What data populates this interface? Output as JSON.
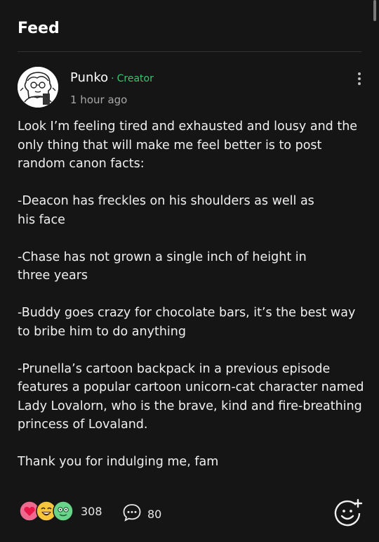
{
  "header": {
    "title": "Feed"
  },
  "post": {
    "author": "Punko",
    "separator": "·",
    "role": "Creator",
    "time": "1 hour ago",
    "paragraphs": [
      "Look I’m feeling tired and exhausted and lousy and the only thing that will make me feel better is to post random canon facts:",
      "-Deacon has freckles on his shoulders as well as his face",
      "-Chase has not grown a single inch of height in three years",
      "-Buddy goes crazy for chocolate bars, it’s the best way to bribe him to do anything",
      "-Prunella’s cartoon backpack in a previous episode features a popular cartoon unicorn-cat character named Lady Lovalorn, who is the brave, kind and fire-breathing princess of Lovaland.",
      "Thank you for indulging me, fam"
    ]
  },
  "footer": {
    "reaction_count": "308",
    "comment_count": "80"
  },
  "icons": {
    "reactions": [
      "heart-reaction-icon",
      "laughing-face-reaction-icon",
      "green-face-reaction-icon"
    ],
    "comment": "speech-bubble-icon",
    "add_reaction": "smiley-plus-icon",
    "more": "vertical-dots-icon"
  },
  "colors": {
    "background": "#151515",
    "accent_green": "#3ec46d",
    "heart_pink": "#ee6b8f",
    "laugh_yellow": "#f5c63c",
    "face_green": "#6ad38a"
  }
}
